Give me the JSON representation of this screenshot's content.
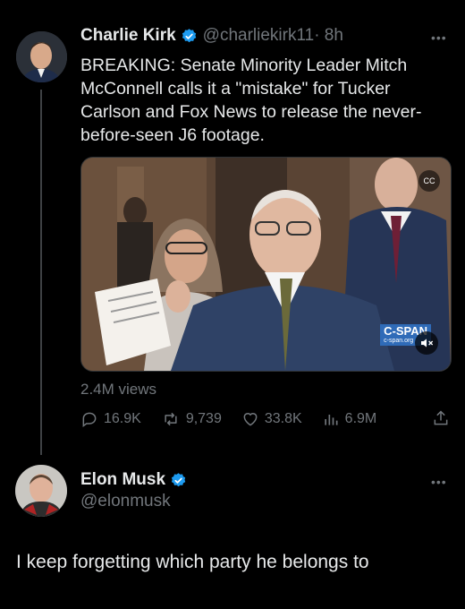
{
  "tweet": {
    "name": "Charlie Kirk",
    "handle": "@charliekirk11",
    "time": "· 8h",
    "text": "BREAKING: Senate Minority Leader Mitch McConnell calls it a \"mistake\" for Tucker Carlson and Fox News to release the never-before-seen J6 footage.",
    "video_logo": "C-SPAN",
    "video_url": "c-span.org",
    "views": "2.4M views",
    "stats": {
      "replies": "16.9K",
      "retweets": "9,739",
      "likes": "33.8K",
      "views": "6.9M"
    }
  },
  "reply": {
    "name": "Elon Musk",
    "handle": "@elonmusk",
    "text": "I keep forgetting which party he belongs to"
  },
  "colors": {
    "background": "#000000",
    "text": "#e7e9ea",
    "muted": "#71767b",
    "verified": "#1d9bf0"
  }
}
